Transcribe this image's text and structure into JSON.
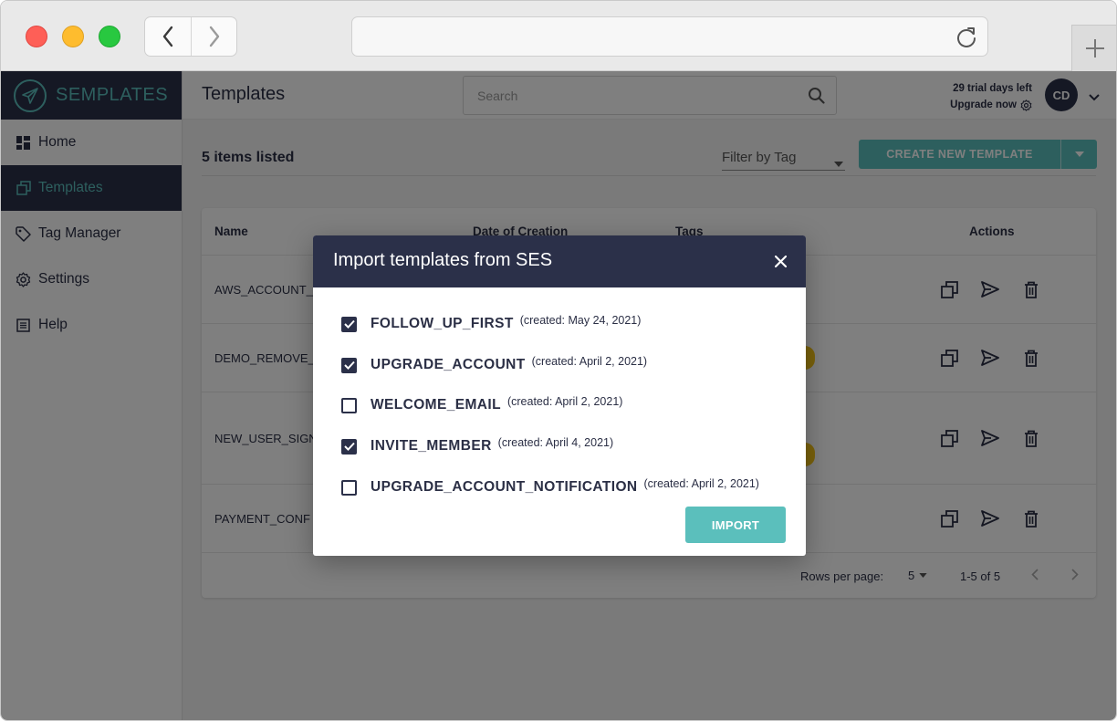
{
  "app": {
    "brand": "SEMPLATES",
    "page_title": "Templates"
  },
  "sidebar": {
    "items": [
      {
        "label": "Home",
        "icon": "dashboard-icon"
      },
      {
        "label": "Templates",
        "icon": "templates-icon",
        "active": true
      },
      {
        "label": "Tag Manager",
        "icon": "tag-icon"
      },
      {
        "label": "Settings",
        "icon": "gear-icon"
      },
      {
        "label": "Help",
        "icon": "document-icon"
      }
    ]
  },
  "header": {
    "search_placeholder": "Search",
    "trial_text": "29 trial days left",
    "upgrade_text": "Upgrade now",
    "avatar_initials": "CD"
  },
  "toolbar": {
    "count_label": "5 items listed",
    "filter_placeholder": "Filter by Tag",
    "create_label": "CREATE NEW TEMPLATE"
  },
  "table": {
    "columns": [
      "Name",
      "Date of Creation",
      "Tags",
      "Actions"
    ],
    "rows": [
      {
        "name": "AWS_ACCOUNT_"
      },
      {
        "name": "DEMO_REMOVE_"
      },
      {
        "name": "NEW_USER_SIGN"
      },
      {
        "name": "PAYMENT_CONF"
      }
    ],
    "footer": {
      "rows_per_page_label": "Rows per page:",
      "rows_per_page_value": "5",
      "range": "1-5 of 5"
    }
  },
  "modal": {
    "title": "Import templates from SES",
    "options": [
      {
        "name": "FOLLOW_UP_FIRST",
        "created": "(created:  May 24, 2021)",
        "checked": true
      },
      {
        "name": "UPGRADE_ACCOUNT",
        "created": "(created:  April 2, 2021)",
        "checked": true
      },
      {
        "name": "WELCOME_EMAIL",
        "created": "(created:  April 2, 2021)",
        "checked": false
      },
      {
        "name": "INVITE_MEMBER",
        "created": "(created:  April 4, 2021)",
        "checked": true
      },
      {
        "name": "UPGRADE_ACCOUNT_NOTIFICATION",
        "created": "(created:  April 2, 2021)",
        "checked": false
      }
    ],
    "import_label": "IMPORT"
  },
  "colors": {
    "navy": "#2b3049",
    "teal": "#5bbfbc",
    "tag_yellow": "#f5c518"
  }
}
